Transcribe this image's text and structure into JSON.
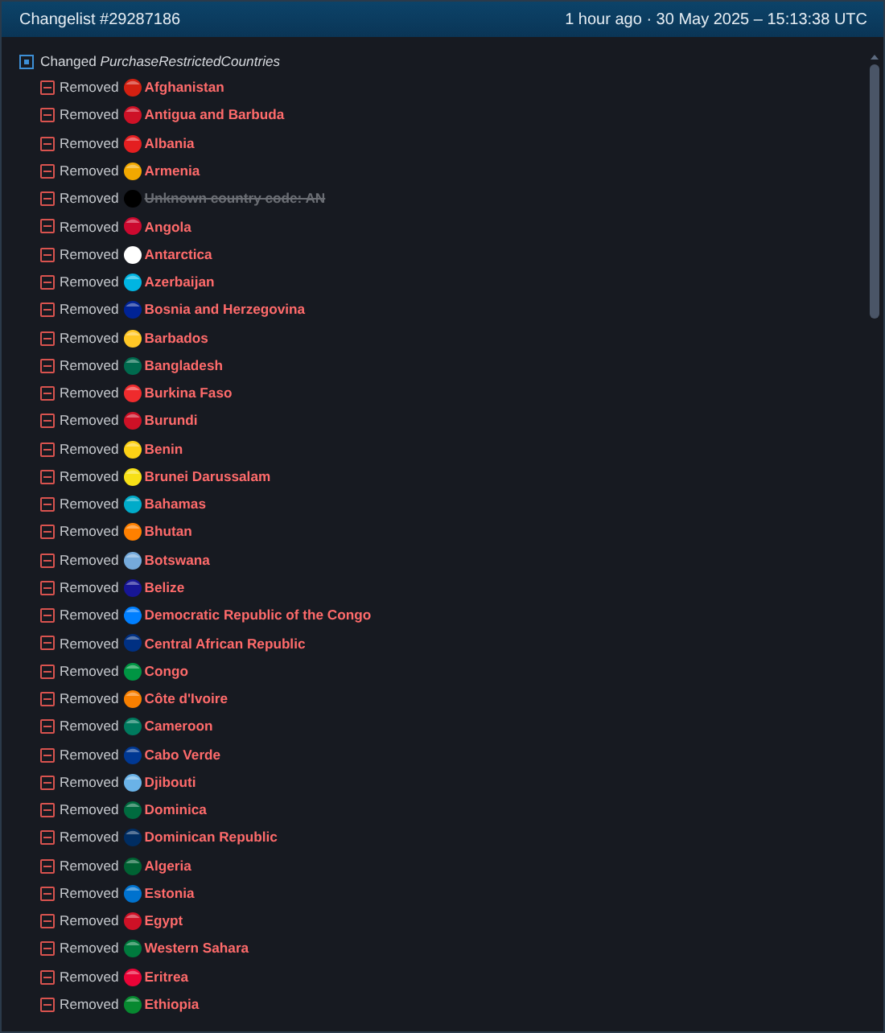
{
  "header": {
    "title": "Changelist #29287186",
    "time": "1 hour ago · 30 May 2025 – 15:13:38 UTC"
  },
  "change": {
    "text": "Changed *PurchaseRestrictedCountries*",
    "expanded": true
  },
  "items": [
    {
      "action": "Removed",
      "name": "Afghanistan",
      "kind": "country",
      "color": "#d32011"
    },
    {
      "action": "Removed",
      "name": "Antigua and Barbuda",
      "kind": "country",
      "color": "#ce1126"
    },
    {
      "action": "Removed",
      "name": "Albania",
      "kind": "country",
      "color": "#e41e20"
    },
    {
      "action": "Removed",
      "name": "Armenia",
      "kind": "country",
      "color": "#f2a800"
    },
    {
      "action": "Removed",
      "name": "Unknown country code: AN",
      "kind": "unknown",
      "color": "#000000"
    },
    {
      "action": "Removed",
      "name": "Angola",
      "kind": "country",
      "color": "#cc092f"
    },
    {
      "action": "Removed",
      "name": "Antarctica",
      "kind": "country",
      "color": "#ffffff"
    },
    {
      "action": "Removed",
      "name": "Azerbaijan",
      "kind": "country",
      "color": "#00b5e2"
    },
    {
      "action": "Removed",
      "name": "Bosnia and Herzegovina",
      "kind": "country",
      "color": "#002395"
    },
    {
      "action": "Removed",
      "name": "Barbados",
      "kind": "country",
      "color": "#ffc726"
    },
    {
      "action": "Removed",
      "name": "Bangladesh",
      "kind": "country",
      "color": "#006a4e"
    },
    {
      "action": "Removed",
      "name": "Burkina Faso",
      "kind": "country",
      "color": "#ef2b2d"
    },
    {
      "action": "Removed",
      "name": "Burundi",
      "kind": "country",
      "color": "#ce1126"
    },
    {
      "action": "Removed",
      "name": "Benin",
      "kind": "country",
      "color": "#fcd116"
    },
    {
      "action": "Removed",
      "name": "Brunei Darussalam",
      "kind": "country",
      "color": "#f7e017"
    },
    {
      "action": "Removed",
      "name": "Bahamas",
      "kind": "country",
      "color": "#00abc9"
    },
    {
      "action": "Removed",
      "name": "Bhutan",
      "kind": "country",
      "color": "#ff8000"
    },
    {
      "action": "Removed",
      "name": "Botswana",
      "kind": "country",
      "color": "#75aadb"
    },
    {
      "action": "Removed",
      "name": "Belize",
      "kind": "country",
      "color": "#171696"
    },
    {
      "action": "Removed",
      "name": "Democratic Republic of the Congo",
      "kind": "country",
      "color": "#007fff"
    },
    {
      "action": "Removed",
      "name": "Central African Republic",
      "kind": "country",
      "color": "#003082"
    },
    {
      "action": "Removed",
      "name": "Congo",
      "kind": "country",
      "color": "#009543"
    },
    {
      "action": "Removed",
      "name": "Côte d'Ivoire",
      "kind": "country",
      "color": "#f77f00"
    },
    {
      "action": "Removed",
      "name": "Cameroon",
      "kind": "country",
      "color": "#007a5e"
    },
    {
      "action": "Removed",
      "name": "Cabo Verde",
      "kind": "country",
      "color": "#003893"
    },
    {
      "action": "Removed",
      "name": "Djibouti",
      "kind": "country",
      "color": "#6ab2e7"
    },
    {
      "action": "Removed",
      "name": "Dominica",
      "kind": "country",
      "color": "#006b3f"
    },
    {
      "action": "Removed",
      "name": "Dominican Republic",
      "kind": "country",
      "color": "#002d62"
    },
    {
      "action": "Removed",
      "name": "Algeria",
      "kind": "country",
      "color": "#006233"
    },
    {
      "action": "Removed",
      "name": "Estonia",
      "kind": "country",
      "color": "#0072ce"
    },
    {
      "action": "Removed",
      "name": "Egypt",
      "kind": "country",
      "color": "#ce1126"
    },
    {
      "action": "Removed",
      "name": "Western Sahara",
      "kind": "country",
      "color": "#007a3d"
    },
    {
      "action": "Removed",
      "name": "Eritrea",
      "kind": "country",
      "color": "#ea0437"
    },
    {
      "action": "Removed",
      "name": "Ethiopia",
      "kind": "country",
      "color": "#078930"
    }
  ]
}
